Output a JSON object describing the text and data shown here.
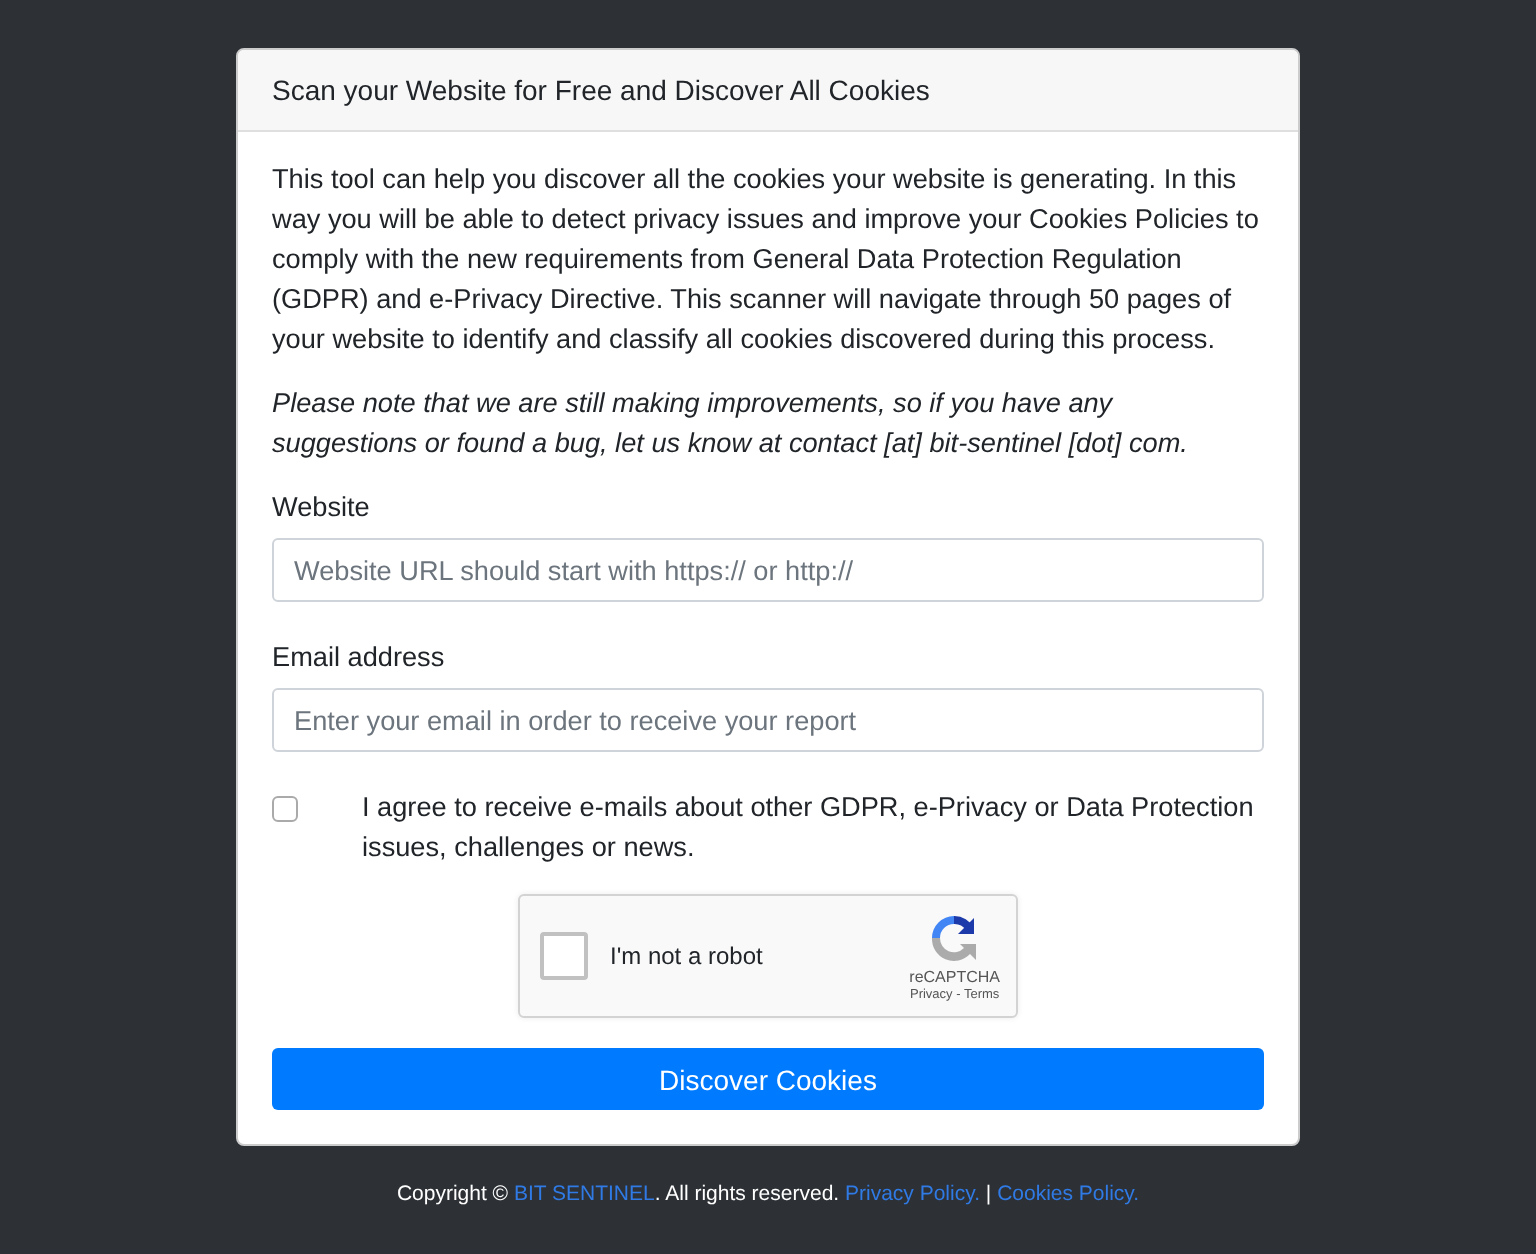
{
  "card": {
    "title": "Scan your Website for Free and Discover All Cookies"
  },
  "intro": "This tool can help you discover all the cookies your website is generating. In this way you will be able to detect privacy issues and improve your Cookies Policies to comply with the new requirements from General Data Protection Regulation (GDPR) and e-Privacy Directive. This scanner will navigate through 50 pages of your website to identify and classify all cookies discovered during this process.",
  "note": "Please note that we are still making improvements, so if you have any suggestions or found a bug, let us know at contact [at] bit-sentinel [dot] com.",
  "fields": [
    {
      "label": "Website",
      "placeholder": "Website URL should start with https:// or http://"
    },
    {
      "label": "Email address",
      "placeholder": "Enter your email in order to receive your report"
    }
  ],
  "consent": {
    "label": "I agree to receive e-mails about other GDPR, e-Privacy or Data Protection issues, challenges or news.",
    "checked": false
  },
  "captcha": {
    "label": "I'm not a robot",
    "checked": false,
    "brand": "reCAPTCHA",
    "links": "Privacy - Terms"
  },
  "submit": "Discover Cookies",
  "footer": [
    {
      "kind": "text",
      "text": "Copyright © "
    },
    {
      "kind": "link",
      "text": "BIT SENTINEL"
    },
    {
      "kind": "text",
      "text": ". All rights reserved. "
    },
    {
      "kind": "link",
      "text": "Privacy Policy."
    },
    {
      "kind": "text",
      "text": " | "
    },
    {
      "kind": "link",
      "text": "Cookies Policy."
    }
  ]
}
